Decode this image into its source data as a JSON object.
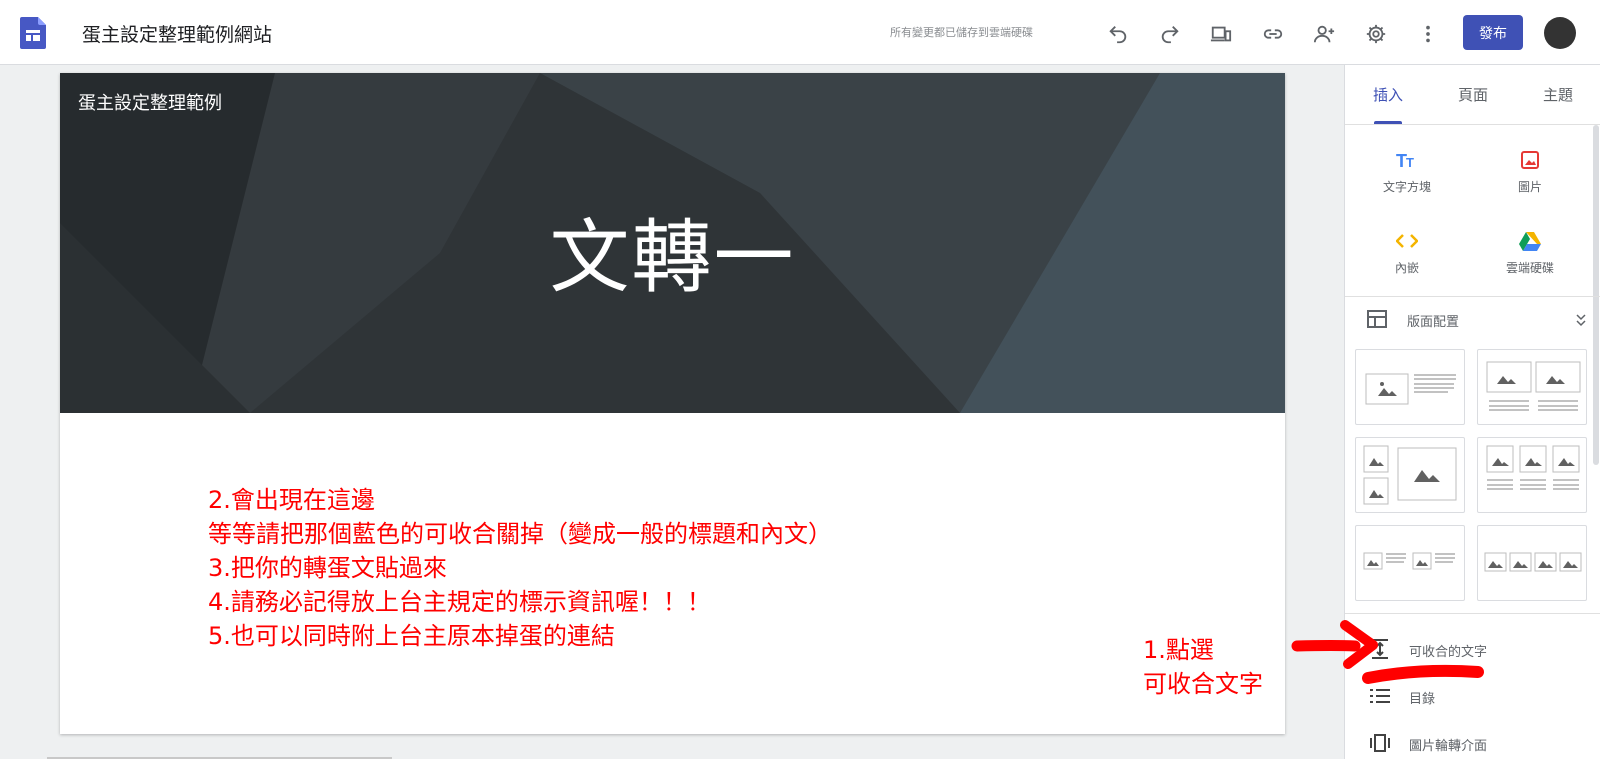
{
  "app": {
    "site_title": "蛋主設定整理範例網站",
    "save_status": "所有變更都已儲存到雲端硬碟",
    "publish_label": "發布"
  },
  "toolbar_icons": [
    "undo-icon",
    "redo-icon",
    "device-preview-icon",
    "link-icon",
    "share-person-icon",
    "settings-gear-icon",
    "more-vert-icon"
  ],
  "hero": {
    "site_name": "蛋主設定整理範例",
    "title": "文轉一"
  },
  "notes": [
    "2.會出現在這邊",
    "等等請把那個藍色的可收合關掉（變成一般的標題和內文）",
    "3.把你的轉蛋文貼過來",
    "4.請務必記得放上台主規定的標示資訊喔！！！",
    "5.也可以同時附上台主原本掉蛋的連結"
  ],
  "hint": [
    "1.點選",
    "可收合文字"
  ],
  "sidepanel": {
    "tabs": [
      {
        "label": "插入",
        "active": true
      },
      {
        "label": "頁面",
        "active": false
      },
      {
        "label": "主題",
        "active": false
      }
    ],
    "insert_items": [
      {
        "label": "文字方塊",
        "icon": "text-box-icon"
      },
      {
        "label": "圖片",
        "icon": "image-icon"
      },
      {
        "label": "內嵌",
        "icon": "embed-code-icon"
      },
      {
        "label": "雲端硬碟",
        "icon": "google-drive-icon"
      }
    ],
    "layout_section_label": "版面配置",
    "list_items": [
      {
        "label": "可收合的文字",
        "icon": "collapsible-text-icon"
      },
      {
        "label": "目錄",
        "icon": "table-of-contents-icon"
      },
      {
        "label": "圖片輪轉介面",
        "icon": "image-carousel-icon"
      }
    ]
  },
  "colors": {
    "accent": "#3f51b5",
    "annotation_red": "#ff0000",
    "hero_bg": "#2f3437"
  }
}
